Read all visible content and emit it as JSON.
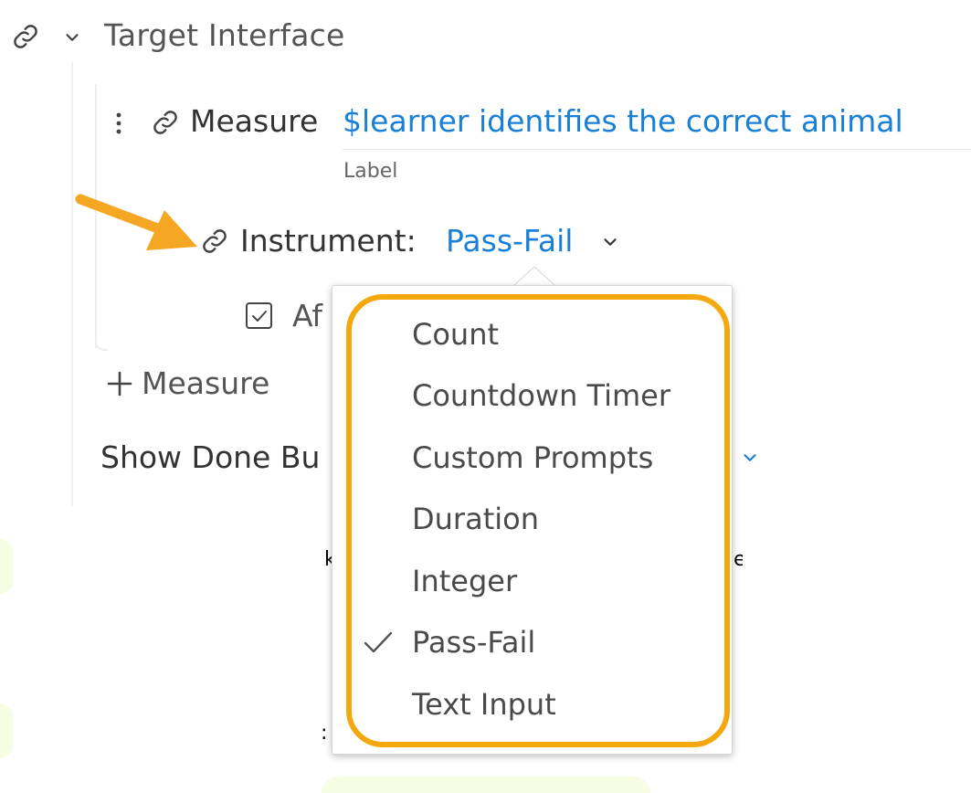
{
  "header": {
    "title": "Target Interface"
  },
  "measure": {
    "prefix": "Measure",
    "value": "$learner identifies the correct animal",
    "field_label": "Label"
  },
  "instrument": {
    "prefix": "Instrument:",
    "selected": "Pass-Fail"
  },
  "checkbox_row": {
    "label_partial": "Af"
  },
  "add_measure": {
    "label": "Measure"
  },
  "show_done": {
    "label_partial": "Show Done Bu"
  },
  "dropdown": {
    "options": [
      {
        "label": "Count",
        "selected": false
      },
      {
        "label": "Countdown Timer",
        "selected": false
      },
      {
        "label": "Custom Prompts",
        "selected": false
      },
      {
        "label": "Duration",
        "selected": false
      },
      {
        "label": "Integer",
        "selected": false
      },
      {
        "label": "Pass-Fail",
        "selected": true
      },
      {
        "label": "Text Input",
        "selected": false
      }
    ]
  },
  "colors": {
    "accent_blue": "#1a7fd6",
    "highlight_orange": "#f4a80d",
    "arrow_orange": "#f5a623"
  },
  "icons": {
    "link": "link-icon",
    "chevron": "chevron-down-icon",
    "kebab": "more-vertical-icon",
    "checkbox": "checkbox-checked-icon",
    "plus": "plus-icon",
    "check": "checkmark-icon",
    "arrow": "annotation-arrow-icon"
  }
}
